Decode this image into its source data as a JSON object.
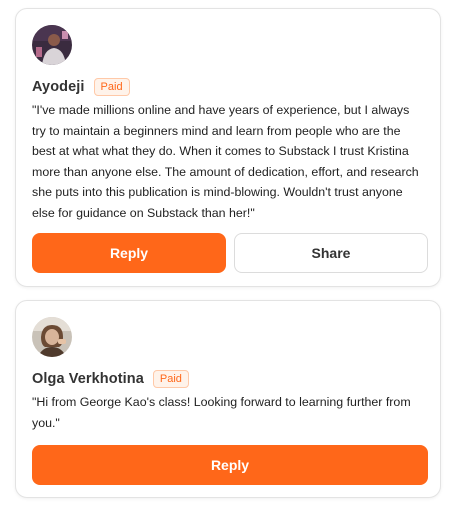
{
  "comments": [
    {
      "author": "Ayodeji",
      "badge": "Paid",
      "avatar": "avatar-photo",
      "text": "\"I've made millions online and have years of experience, but I always try to maintain a beginners mind and learn from people who are the best at what what they do. When it comes to Substack I trust Kristina more than anyone else. The amount of dedication, effort, and research she puts into this publication is mind-blowing. Wouldn't trust anyone else for guidance on Substack than her!\"",
      "reply_label": "Reply",
      "share_label": "Share"
    },
    {
      "author": "Olga Verkhotina",
      "badge": "Paid",
      "avatar": "avatar-photo",
      "text": "\"Hi from George Kao's class! Looking forward to learning further from you.\"",
      "reply_label": "Reply"
    }
  ],
  "colors": {
    "accent": "#ff6719",
    "badge_bg": "#fff3ea",
    "badge_border": "#ffc9a8",
    "card_border": "#e3e3e3"
  }
}
